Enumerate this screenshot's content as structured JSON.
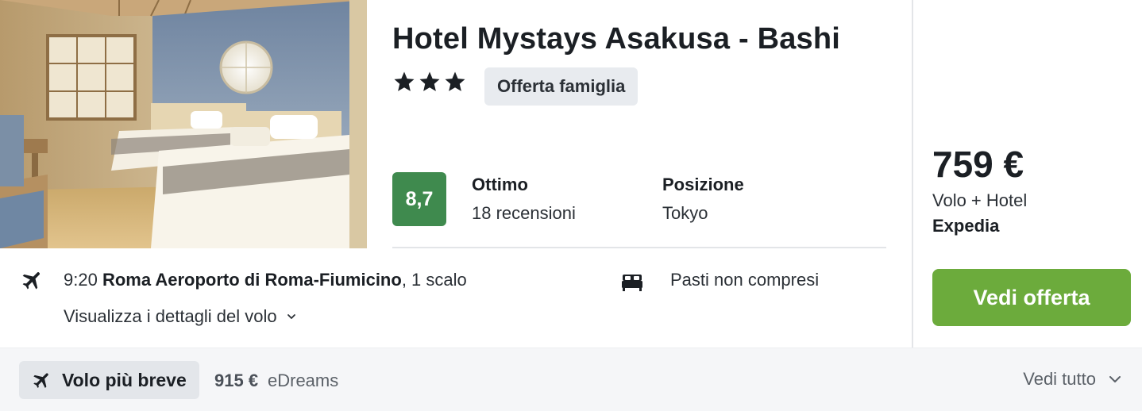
{
  "hotel": {
    "name": "Hotel Mystays Asakusa - Bashi",
    "stars": 3,
    "tag": "Offerta famiglia",
    "score": "8,7",
    "rating_label": "Ottimo",
    "reviews": "18 recensioni",
    "location_label": "Posizione",
    "location": "Tokyo",
    "photo_icon": "hotel-room-photo"
  },
  "flight": {
    "time": "9:20",
    "airport": "Roma Aeroporto di Roma-Fiumicino",
    "stops": ", 1 scalo",
    "details_link": "Visualizza i dettagli del volo",
    "icon": "plane-icon"
  },
  "meals": {
    "text": "Pasti non compresi",
    "icon": "bed-icon"
  },
  "offer": {
    "price": "759 €",
    "type": "Volo + Hotel",
    "provider": "Expedia",
    "cta": "Vedi offerta",
    "cta_color": "#6cab3c"
  },
  "footer": {
    "chip_label": "Volo più breve",
    "alt_price": "915 €",
    "alt_provider": "eDreams",
    "see_all": "Vedi tutto"
  },
  "colors": {
    "score_bg": "#3f8a4e",
    "footer_bg": "#f5f6f8"
  }
}
